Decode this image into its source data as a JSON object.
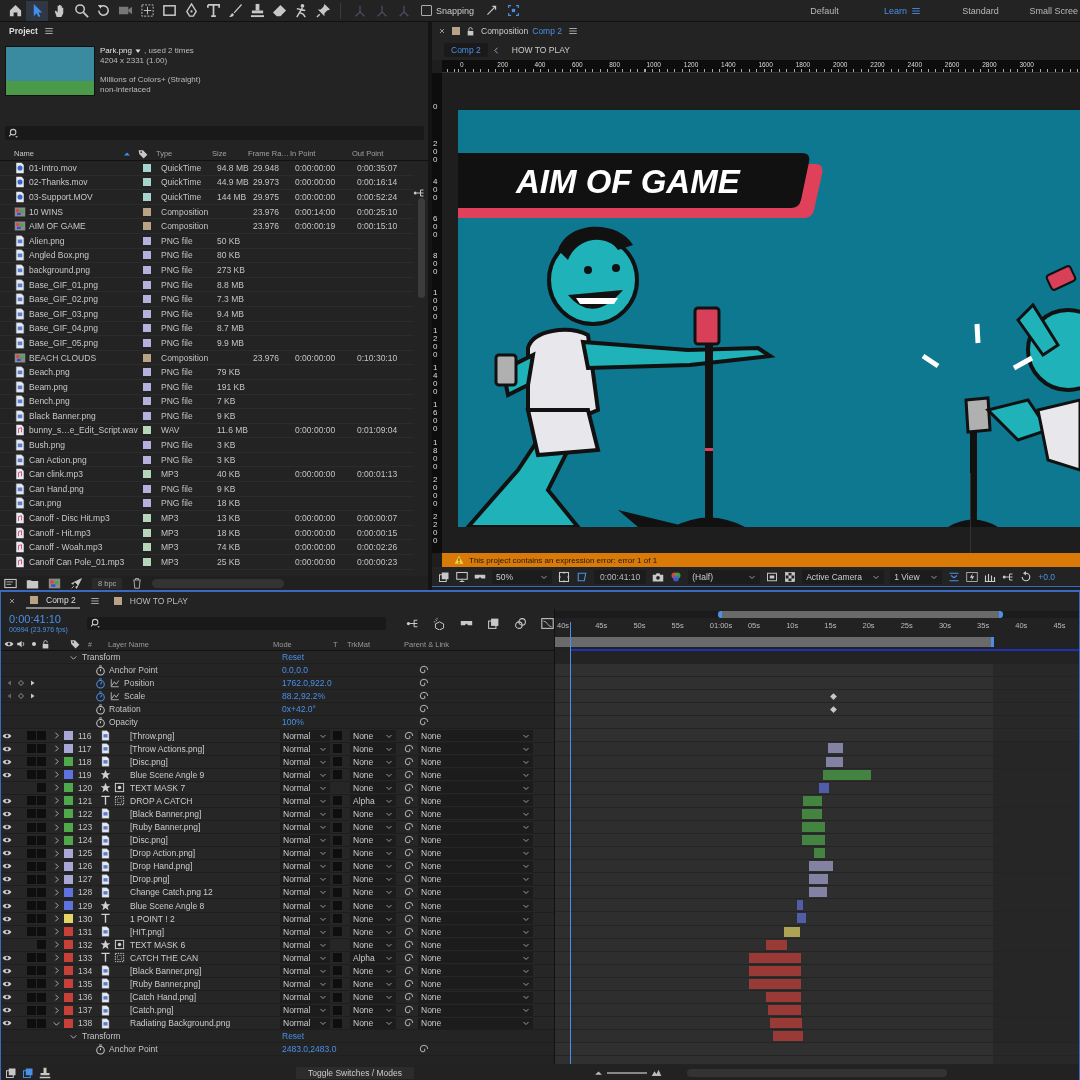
{
  "toolbar": {
    "snapping": {
      "label": "Snapping",
      "checked": false
    },
    "workspaces": [
      {
        "label": "Default",
        "selected": false
      },
      {
        "label": "Learn",
        "selected": true
      },
      {
        "label": "Standard",
        "selected": false
      },
      {
        "label": "Small Scree",
        "selected": false
      }
    ]
  },
  "project": {
    "title": "Project",
    "preview": {
      "name": "Park.png",
      "usage": ", used 2 times",
      "dimensions": "4204 x 2331 (1.00)",
      "colors": "Millions of Colors+ (Straight)",
      "interlace": "non-interlaced"
    },
    "columns": [
      "Name",
      "Type",
      "Size",
      "Frame Ra…",
      "In Point",
      "Out Point"
    ],
    "items": [
      {
        "name": "01-Intro.mov",
        "kind": "video",
        "color": "#a6d4cc",
        "type": "QuickTime",
        "size": "94.8 MB",
        "fps": "29.948",
        "in": "0:00:00:00",
        "out": "0:00:35:07"
      },
      {
        "name": "02-Thanks.mov",
        "kind": "video",
        "color": "#a6d4cc",
        "type": "QuickTime",
        "size": "44.9 MB",
        "fps": "29.973",
        "in": "0:00:00:00",
        "out": "0:00:16:14"
      },
      {
        "name": "03-Support.MOV",
        "kind": "video",
        "color": "#a6d4cc",
        "type": "QuickTime",
        "size": "144 MB",
        "fps": "29.975",
        "in": "0:00:00:00",
        "out": "0:00:52:24"
      },
      {
        "name": "10 WINS",
        "kind": "comp",
        "color": "#b8a387",
        "type": "Composition",
        "fps": "23.976",
        "in": "0:00:14:00",
        "out": "0:00:25:10"
      },
      {
        "name": "AIM OF GAME",
        "kind": "comp",
        "color": "#b8a387",
        "type": "Composition",
        "fps": "23.976",
        "in": "0:00:00:19",
        "out": "0:00:15:10"
      },
      {
        "name": "Alien.png",
        "kind": "image",
        "color": "#b4b2dc",
        "type": "PNG file",
        "size": "50 KB"
      },
      {
        "name": "Angled Box.png",
        "kind": "image",
        "color": "#b4b2dc",
        "type": "PNG file",
        "size": "80 KB"
      },
      {
        "name": "background.png",
        "kind": "image",
        "color": "#b4b2dc",
        "type": "PNG file",
        "size": "273 KB"
      },
      {
        "name": "Base_GIF_01.png",
        "kind": "image",
        "color": "#b4b2dc",
        "type": "PNG file",
        "size": "8.8 MB"
      },
      {
        "name": "Base_GIF_02.png",
        "kind": "image",
        "color": "#b4b2dc",
        "type": "PNG file",
        "size": "7.3 MB"
      },
      {
        "name": "Base_GIF_03.png",
        "kind": "image",
        "color": "#b4b2dc",
        "type": "PNG file",
        "size": "9.4 MB"
      },
      {
        "name": "Base_GIF_04.png",
        "kind": "image",
        "color": "#b4b2dc",
        "type": "PNG file",
        "size": "8.7 MB"
      },
      {
        "name": "Base_GIF_05.png",
        "kind": "image",
        "color": "#b4b2dc",
        "type": "PNG file",
        "size": "9.9 MB"
      },
      {
        "name": "BEACH CLOUDS",
        "kind": "comp",
        "color": "#b8a387",
        "type": "Composition",
        "fps": "23.976",
        "in": "0:00:00:00",
        "out": "0:10:30:10"
      },
      {
        "name": "Beach.png",
        "kind": "image",
        "color": "#b4b2dc",
        "type": "PNG file",
        "size": "79 KB"
      },
      {
        "name": "Beam.png",
        "kind": "image",
        "color": "#b4b2dc",
        "type": "PNG file",
        "size": "191 KB"
      },
      {
        "name": "Bench.png",
        "kind": "image",
        "color": "#b4b2dc",
        "type": "PNG file",
        "size": "7 KB"
      },
      {
        "name": "Black Banner.png",
        "kind": "image",
        "color": "#b4b2dc",
        "type": "PNG file",
        "size": "9 KB"
      },
      {
        "name": "bunny_s…e_Edit_Script.wav",
        "kind": "audio",
        "color": "#b5d6b9",
        "type": "WAV",
        "size": "11.6 MB",
        "in": "0:00:00:00",
        "out": "0:01:09:04"
      },
      {
        "name": "Bush.png",
        "kind": "image",
        "color": "#b4b2dc",
        "type": "PNG file",
        "size": "3 KB"
      },
      {
        "name": "Can Action.png",
        "kind": "image",
        "color": "#b4b2dc",
        "type": "PNG file",
        "size": "3 KB"
      },
      {
        "name": "Can clink.mp3",
        "kind": "audio",
        "color": "#b5d6b9",
        "type": "MP3",
        "size": "40 KB",
        "in": "0:00:00:00",
        "out": "0:00:01:13"
      },
      {
        "name": "Can Hand.png",
        "kind": "image",
        "color": "#b4b2dc",
        "type": "PNG file",
        "size": "9 KB"
      },
      {
        "name": "Can.png",
        "kind": "image",
        "color": "#b4b2dc",
        "type": "PNG file",
        "size": "18 KB"
      },
      {
        "name": "Canoff - Disc Hit.mp3",
        "kind": "audio",
        "color": "#b5d6b9",
        "type": "MP3",
        "size": "13 KB",
        "in": "0:00:00:00",
        "out": "0:00:00:07"
      },
      {
        "name": "Canoff - Hit.mp3",
        "kind": "audio",
        "color": "#b5d6b9",
        "type": "MP3",
        "size": "18 KB",
        "in": "0:00:00:00",
        "out": "0:00:00:15"
      },
      {
        "name": "Canoff - Woah.mp3",
        "kind": "audio",
        "color": "#b5d6b9",
        "type": "MP3",
        "size": "74 KB",
        "in": "0:00:00:00",
        "out": "0:00:02:26"
      },
      {
        "name": "Canoff Can Pole_01.mp3",
        "kind": "audio",
        "color": "#b5d6b9",
        "type": "MP3",
        "size": "25 KB",
        "in": "0:00:00:00",
        "out": "0:00:00:23"
      }
    ],
    "bit_depth": "8 bpc"
  },
  "composition": {
    "label": "Composition",
    "name": "Comp 2",
    "breadcrumbs": [
      {
        "label": "Comp 2",
        "selected": true
      },
      {
        "label": "HOW TO PLAY",
        "selected": false
      }
    ],
    "ruler": [
      "0",
      "200",
      "400",
      "600",
      "800",
      "1000",
      "1200",
      "1400",
      "1600",
      "1800",
      "2000",
      "2200",
      "2400",
      "2600",
      "2800",
      "3000"
    ],
    "vertical_ruler": [
      "0",
      "200",
      "400",
      "600",
      "800",
      "1000",
      "1200",
      "1400",
      "1600",
      "1800",
      "2000",
      "2200"
    ],
    "banner": "AIM OF GAME",
    "error": "This project contains an expression error: error 1 of 1",
    "viewer": {
      "zoom": "50%",
      "time": "0:00:41:10",
      "resolution": "(Half)",
      "camera": "Active Camera",
      "views": "1 View",
      "exposure": "+0.0"
    }
  },
  "timeline": {
    "tabs": [
      {
        "label": "Comp 2",
        "selected": true
      },
      {
        "label": "HOW TO PLAY",
        "selected": false
      }
    ],
    "current_time": "0:00:41:10",
    "frame_info": "00994 (23.976 fps)",
    "columns": [
      "#",
      "Layer Name",
      "Mode",
      "T",
      "TrkMat",
      "Parent & Link"
    ],
    "ruler": [
      "40s",
      "45s",
      "50s",
      "55s",
      "01:00s",
      "05s",
      "10s",
      "15s",
      "20s",
      "25s",
      "30s",
      "35s",
      "40s",
      "45s"
    ],
    "top_properties": {
      "group": "Transform",
      "reset": "Reset",
      "items": [
        {
          "name": "Anchor Point",
          "value": "0.0,0.0",
          "animated": false
        },
        {
          "name": "Position",
          "value": "1762.0,922.0",
          "animated": true
        },
        {
          "name": "Scale",
          "value": "88.2,92.2%",
          "animated": true
        },
        {
          "name": "Rotation",
          "value": "0x+42.0°",
          "animated": false
        },
        {
          "name": "Opacity",
          "value": "100%",
          "animated": false
        }
      ]
    },
    "layers": [
      {
        "number": "116",
        "name": "[Throw.png]",
        "kind": "footage",
        "color": "#a9a7d6",
        "visible": true,
        "mode": "Normal",
        "trkmat": "None",
        "parent": "None",
        "expanded": false
      },
      {
        "number": "117",
        "name": "[Throw Actions.png]",
        "kind": "footage",
        "color": "#a9a7d6",
        "visible": true,
        "mode": "Normal",
        "trkmat": "None",
        "parent": "None",
        "expanded": false
      },
      {
        "number": "118",
        "name": "[Disc.png]",
        "kind": "footage",
        "color": "#4fa94a",
        "visible": true,
        "mode": "Normal",
        "trkmat": "None",
        "parent": "None",
        "expanded": false
      },
      {
        "number": "119",
        "name": "Blue Scene Angle 9",
        "kind": "shape",
        "color": "#5f73e0",
        "visible": true,
        "mode": "Normal",
        "trkmat": "None",
        "parent": "None",
        "expanded": false
      },
      {
        "number": "120",
        "name": "TEXT MASK 7",
        "kind": "shape-mask",
        "color": "#4fa94a",
        "visible": false,
        "mode": "Normal",
        "trkmat": "None",
        "parent": "None",
        "expanded": false
      },
      {
        "number": "121",
        "name": "DROP A CATCH",
        "kind": "text-matte",
        "color": "#4fa94a",
        "visible": true,
        "mode": "Normal",
        "trkmat": "Alpha",
        "parent": "None",
        "expanded": false
      },
      {
        "number": "122",
        "name": "[Black Banner.png]",
        "kind": "footage",
        "color": "#4fa94a",
        "visible": true,
        "mode": "Normal",
        "trkmat": "None",
        "parent": "None",
        "expanded": false
      },
      {
        "number": "123",
        "name": "[Ruby Banner.png]",
        "kind": "footage",
        "color": "#4fa94a",
        "visible": true,
        "mode": "Normal",
        "trkmat": "None",
        "parent": "None",
        "expanded": false
      },
      {
        "number": "124",
        "name": "[Disc.png]",
        "kind": "footage",
        "color": "#4fa94a",
        "visible": true,
        "mode": "Normal",
        "trkmat": "None",
        "parent": "None",
        "expanded": false
      },
      {
        "number": "125",
        "name": "[Drop Action.png]",
        "kind": "footage",
        "color": "#a9a7d6",
        "visible": true,
        "mode": "Normal",
        "trkmat": "None",
        "parent": "None",
        "expanded": false
      },
      {
        "number": "126",
        "name": "[Drop Hand.png]",
        "kind": "footage",
        "color": "#a9a7d6",
        "visible": true,
        "mode": "Normal",
        "trkmat": "None",
        "parent": "None",
        "expanded": false
      },
      {
        "number": "127",
        "name": "[Drop.png]",
        "kind": "footage",
        "color": "#a9a7d6",
        "visible": true,
        "mode": "Normal",
        "trkmat": "None",
        "parent": "None",
        "expanded": false
      },
      {
        "number": "128",
        "name": "Change Catch.png 12",
        "kind": "footage",
        "color": "#5f73e0",
        "visible": true,
        "mode": "Normal",
        "trkmat": "None",
        "parent": "None",
        "expanded": false
      },
      {
        "number": "129",
        "name": "Blue Scene Angle 8",
        "kind": "shape",
        "color": "#5f73e0",
        "visible": true,
        "mode": "Normal",
        "trkmat": "None",
        "parent": "None",
        "expanded": false
      },
      {
        "number": "130",
        "name": "1 POINT ! 2",
        "kind": "text",
        "color": "#e3d566",
        "visible": true,
        "mode": "Normal",
        "trkmat": "None",
        "parent": "None",
        "expanded": false
      },
      {
        "number": "131",
        "name": "[HIT.png]",
        "kind": "footage",
        "color": "#c9403a",
        "visible": true,
        "mode": "Normal",
        "trkmat": "None",
        "parent": "None",
        "expanded": false
      },
      {
        "number": "132",
        "name": "TEXT MASK 6",
        "kind": "shape-mask",
        "color": "#c9403a",
        "visible": false,
        "mode": "Normal",
        "trkmat": "None",
        "parent": "None",
        "expanded": false
      },
      {
        "number": "133",
        "name": "CATCH THE CAN",
        "kind": "text-matte",
        "color": "#c9403a",
        "visible": true,
        "mode": "Normal",
        "trkmat": "Alpha",
        "parent": "None",
        "expanded": false
      },
      {
        "number": "134",
        "name": "[Black Banner.png]",
        "kind": "footage",
        "color": "#c9403a",
        "visible": true,
        "mode": "Normal",
        "trkmat": "None",
        "parent": "None",
        "expanded": false
      },
      {
        "number": "135",
        "name": "[Ruby Banner.png]",
        "kind": "footage",
        "color": "#c9403a",
        "visible": true,
        "mode": "Normal",
        "trkmat": "None",
        "parent": "None",
        "expanded": false
      },
      {
        "number": "136",
        "name": "[Catch Hand.png]",
        "kind": "footage",
        "color": "#c9403a",
        "visible": true,
        "mode": "Normal",
        "trkmat": "None",
        "parent": "None",
        "expanded": false
      },
      {
        "number": "137",
        "name": "[Catch.png]",
        "kind": "footage",
        "color": "#c9403a",
        "visible": true,
        "mode": "Normal",
        "trkmat": "None",
        "parent": "None",
        "expanded": false
      },
      {
        "number": "138",
        "name": "Radiating Background.png",
        "kind": "footage",
        "color": "#c9403a",
        "visible": true,
        "mode": "Normal",
        "trkmat": "None",
        "parent": "None",
        "expanded": true
      }
    ],
    "bottom_properties": {
      "group": "Transform",
      "reset": "Reset",
      "items": [
        {
          "name": "Anchor Point",
          "value": "2483.0,2483.0",
          "animated": false
        }
      ]
    },
    "toggle": "Toggle Switches / Modes"
  }
}
